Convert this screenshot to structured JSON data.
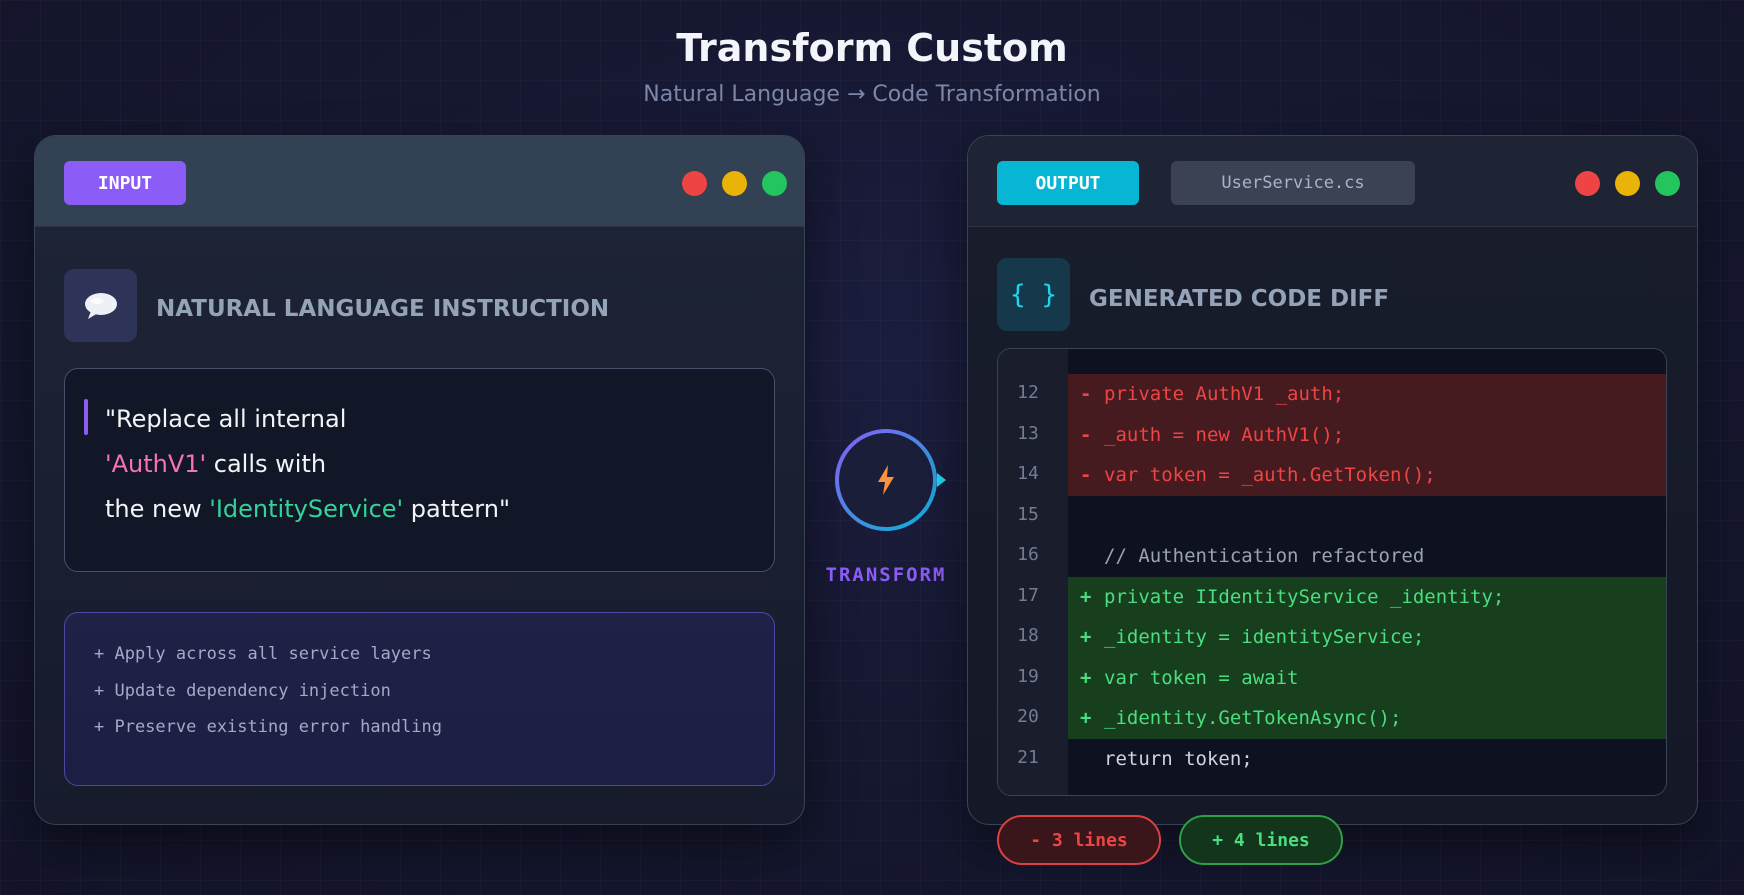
{
  "header": {
    "title": "Transform Custom",
    "subtitle": "Natural Language → Code Transformation"
  },
  "input_panel": {
    "tag": "INPUT",
    "section_label": "NATURAL LANGUAGE INSTRUCTION",
    "instruction": {
      "line1": "\"Replace all internal",
      "highlight1": "'AuthV1'",
      "line2_rest": " calls with",
      "line3_start": "the new ",
      "highlight2": "'IdentityService'",
      "line3_end": " pattern\""
    },
    "notes": [
      "+ Apply across all service layers",
      "+ Update dependency injection",
      "+ Preserve existing error handling"
    ]
  },
  "transform": {
    "label": "TRANSFORM",
    "icon": "lightning-icon"
  },
  "output_panel": {
    "tag": "OUTPUT",
    "file_tab": "UserService.cs",
    "section_label": "GENERATED CODE DIFF",
    "section_icon_text": "{ }",
    "diff": [
      {
        "line": "12",
        "type": "removed",
        "marker": "-",
        "code": "private AuthV1 _auth;"
      },
      {
        "line": "13",
        "type": "removed",
        "marker": "-",
        "code": "_auth = new AuthV1();"
      },
      {
        "line": "14",
        "type": "removed",
        "marker": "-",
        "code": "var token = _auth.GetToken();"
      },
      {
        "line": "15",
        "type": "context",
        "marker": "",
        "code": ""
      },
      {
        "line": "16",
        "type": "comment",
        "marker": "",
        "code": "// Authentication refactored"
      },
      {
        "line": "17",
        "type": "added",
        "marker": "+",
        "code": "private IIdentityService _identity;"
      },
      {
        "line": "18",
        "type": "added",
        "marker": "+",
        "code": "_identity = identityService;"
      },
      {
        "line": "19",
        "type": "added",
        "marker": "+",
        "code": "var token = await"
      },
      {
        "line": "20",
        "type": "added",
        "marker": "+",
        "code": "_identity.GetTokenAsync();"
      },
      {
        "line": "21",
        "type": "context",
        "marker": "",
        "code": "return token;"
      }
    ]
  },
  "stats": {
    "removed": "- 3 lines",
    "added": "+ 4 lines"
  },
  "colors": {
    "input_accent": "#8b5cf6",
    "output_accent": "#06b6d4",
    "removed": "#ef4444",
    "added": "#4ade80"
  }
}
